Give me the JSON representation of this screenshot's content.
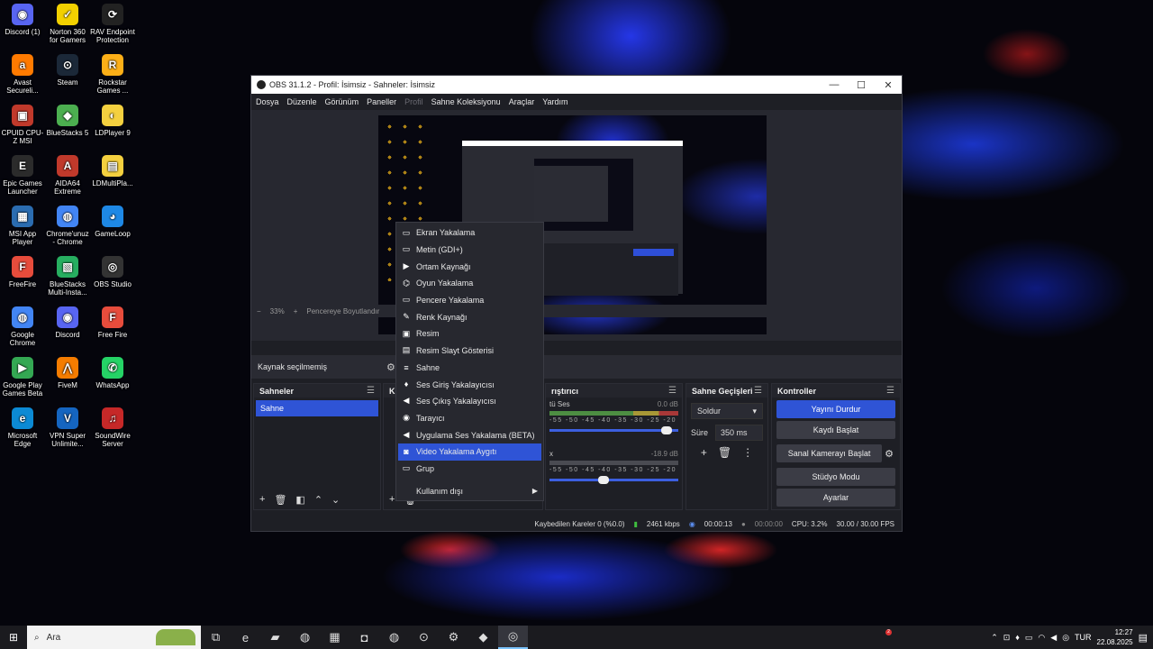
{
  "desktop": {
    "icons": [
      {
        "label": "Discord (1)",
        "color": "#5865f2",
        "glyph": "◉"
      },
      {
        "label": "Norton 360 for Gamers",
        "color": "#f2d000",
        "glyph": "✓"
      },
      {
        "label": "RAV Endpoint Protection",
        "color": "#222222",
        "glyph": "⟳"
      },
      {
        "label": "Avast Secureli...",
        "color": "#ff7a00",
        "glyph": "a"
      },
      {
        "label": "Steam",
        "color": "#1b2838",
        "glyph": "⊙"
      },
      {
        "label": "Rockstar Games ...",
        "color": "#fcaf17",
        "glyph": "R"
      },
      {
        "label": "CPUID CPU-Z MSI",
        "color": "#c0392b",
        "glyph": "▣"
      },
      {
        "label": "BlueStacks 5",
        "color": "#4caf50",
        "glyph": "◆"
      },
      {
        "label": "LDPlayer 9",
        "color": "#f4d03f",
        "glyph": "◐"
      },
      {
        "label": "Epic Games Launcher",
        "color": "#2b2b2b",
        "glyph": "E"
      },
      {
        "label": "AIDA64 Extreme",
        "color": "#c0392b",
        "glyph": "A"
      },
      {
        "label": "LDMultiPla...",
        "color": "#f4d03f",
        "glyph": "▤"
      },
      {
        "label": "MSI App Player",
        "color": "#2b6cb0",
        "glyph": "▦"
      },
      {
        "label": "Chrome'unuz - Chrome",
        "color": "#4285f4",
        "glyph": "◍"
      },
      {
        "label": "GameLoop",
        "color": "#1e88e5",
        "glyph": "◕"
      },
      {
        "label": "FreeFire",
        "color": "#e74c3c",
        "glyph": "F"
      },
      {
        "label": "BlueStacks Multi-Insta...",
        "color": "#27ae60",
        "glyph": "▧"
      },
      {
        "label": "OBS Studio",
        "color": "#333333",
        "glyph": "◎"
      },
      {
        "label": "Google Chrome",
        "color": "#4285f4",
        "glyph": "◍"
      },
      {
        "label": "Discord",
        "color": "#5865f2",
        "glyph": "◉"
      },
      {
        "label": "Free Fire",
        "color": "#e74c3c",
        "glyph": "F"
      },
      {
        "label": "Google Play Games Beta",
        "color": "#34a853",
        "glyph": "▶"
      },
      {
        "label": "FiveM",
        "color": "#f57c00",
        "glyph": "⋀"
      },
      {
        "label": "WhatsApp",
        "color": "#25d366",
        "glyph": "✆"
      },
      {
        "label": "Microsoft Edge",
        "color": "#0c8ad4",
        "glyph": "e"
      },
      {
        "label": "VPN Super Unlimite...",
        "color": "#1565c0",
        "glyph": "V"
      },
      {
        "label": "SoundWire Server",
        "color": "#c62828",
        "glyph": "♫"
      }
    ]
  },
  "window": {
    "title": "OBS 31.1.2 - Profil: İsimsiz - Sahneler: İsimsiz",
    "controls": {
      "minimize": "—",
      "maximize": "☐",
      "close": "✕"
    }
  },
  "menu": [
    "Dosya",
    "Düzenle",
    "Görünüm",
    "Paneller",
    "Profil",
    "Sahne Koleksiyonu",
    "Araçlar",
    "Yardım"
  ],
  "preview_toolbar": {
    "minus": "−",
    "zoom": "33%",
    "plus": "+",
    "fit": "Pencereye Boyutlandır"
  },
  "source_bar": {
    "label": "Kaynak seçilmemiş",
    "gear": "⚙"
  },
  "scenes": {
    "title": "Sahneler",
    "items": [
      "Sahne"
    ]
  },
  "sources_dock": {
    "title": "K"
  },
  "mixer": {
    "title": "rıştırıcı",
    "channels": [
      {
        "name": "tü Ses",
        "db": "0.0 dB",
        "volume": 0.95
      },
      {
        "name": "x",
        "db": "-18.9 dB",
        "volume": 0.46
      }
    ],
    "scale": "-55 -50 -45 -40 -35 -30 -25 -20 -15 -10 -5 0"
  },
  "transitions": {
    "title": "Sahne Geçişleri",
    "selected": "Soldur",
    "duration_label": "Süre",
    "duration_value": "350 ms"
  },
  "controls": {
    "title": "Kontroller",
    "buttons": [
      "Yayını Durdur",
      "Kaydı Başlat",
      "Sanal Kamerayı Başlat",
      "Stüdyo Modu",
      "Ayarlar"
    ]
  },
  "context_menu": {
    "items": [
      {
        "label": "Ekran Yakalama",
        "icon": "▭"
      },
      {
        "label": "Metin (GDI+)",
        "icon": "▭"
      },
      {
        "label": "Ortam Kaynağı",
        "icon": "▶"
      },
      {
        "label": "Oyun Yakalama",
        "icon": "⌬"
      },
      {
        "label": "Pencere Yakalama",
        "icon": "▭"
      },
      {
        "label": "Renk Kaynağı",
        "icon": "✎"
      },
      {
        "label": "Resim",
        "icon": "▣"
      },
      {
        "label": "Resim Slayt Gösterisi",
        "icon": "▤"
      },
      {
        "label": "Sahne",
        "icon": "≡"
      },
      {
        "label": "Ses Giriş Yakalayıcısı",
        "icon": "♦"
      },
      {
        "label": "Ses Çıkış Yakalayıcısı",
        "icon": "◀"
      },
      {
        "label": "Tarayıcı",
        "icon": "◉"
      },
      {
        "label": "Uygulama Ses Yakalama (BETA)",
        "icon": "◀"
      },
      {
        "label": "Video Yakalama Aygıtı",
        "icon": "◙"
      },
      {
        "label": "Grup",
        "icon": "▭"
      }
    ],
    "selected_index": 13,
    "submenu": "Kullanım dışı"
  },
  "statusbar": {
    "dropped": "Kaybedilen Kareler 0 (%0.0)",
    "bitrate": "2461 kbps",
    "stream_time": "00:00:13",
    "rec_time": "00:00:00",
    "cpu": "CPU: 3.2%",
    "fps": "30.00 / 30.00 FPS"
  },
  "taskbar": {
    "search_placeholder": "Ara",
    "apps": [
      "⧉",
      "e",
      "▰",
      "◍",
      "▦",
      "◘",
      "◍",
      "⊙",
      "⚙",
      "◆",
      "◎"
    ],
    "active_index": 10,
    "lang": "TUR",
    "time": "12:27",
    "date": "22.08.2025",
    "notification_badge": "2"
  }
}
